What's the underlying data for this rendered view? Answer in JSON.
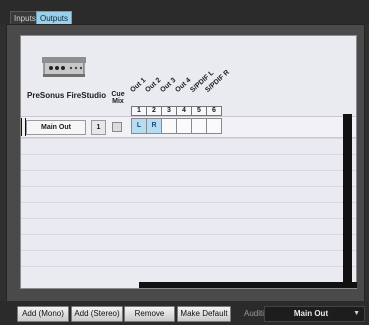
{
  "tabs": [
    {
      "label": "Inputs",
      "active": false
    },
    {
      "label": "Outputs",
      "active": true
    }
  ],
  "device": {
    "name": "PreSonus FireStudio"
  },
  "cue_mix_label": "Cue\nMix",
  "outputs": [
    {
      "label": "Out 1",
      "num": "1"
    },
    {
      "label": "Out 2",
      "num": "2"
    },
    {
      "label": "Out 3",
      "num": "3"
    },
    {
      "label": "Out 4",
      "num": "4"
    },
    {
      "label": "S/PDIF L",
      "num": "5"
    },
    {
      "label": "S/PDIF R",
      "num": "6"
    }
  ],
  "routes": [
    {
      "name": "Main Out",
      "number": "1",
      "cells": [
        "L",
        "R",
        "",
        "",
        "",
        ""
      ]
    }
  ],
  "buttons": {
    "add_mono": "Add (Mono)",
    "add_stereo": "Add (Stereo)",
    "remove": "Remove",
    "make_default": "Make Default"
  },
  "audition": {
    "label": "Audition",
    "value": "Main Out"
  },
  "colors": {
    "active_tab": "#9bd0ea",
    "panel_bg": "#4a4a4a",
    "grid_bg": "#eaeaf1",
    "assigned_cell": "#b8dcf2"
  }
}
